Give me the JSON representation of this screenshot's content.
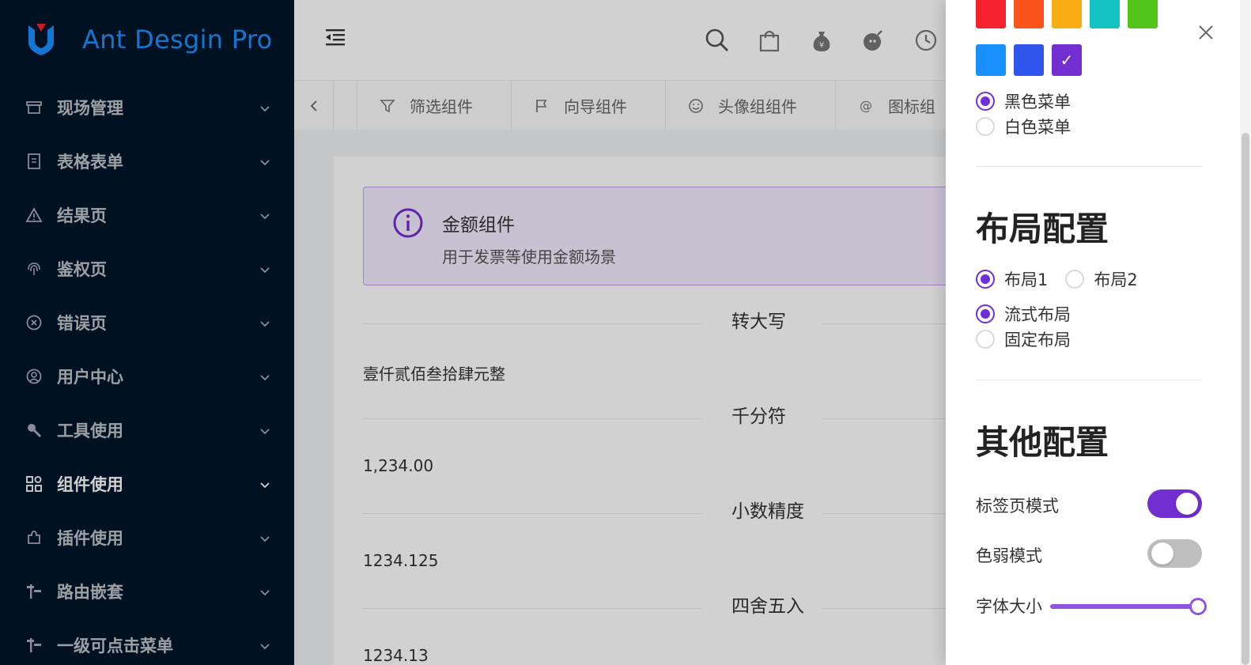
{
  "app": {
    "title": "Ant Desgin Pro"
  },
  "sidebar": {
    "items": [
      {
        "label": "现场管理",
        "icon": "shop-icon",
        "active": false
      },
      {
        "label": "表格表单",
        "icon": "form-icon",
        "active": false
      },
      {
        "label": "结果页",
        "icon": "warning-icon",
        "active": false
      },
      {
        "label": "鉴权页",
        "icon": "fingerprint-icon",
        "active": false
      },
      {
        "label": "错误页",
        "icon": "close-circle-icon",
        "active": false
      },
      {
        "label": "用户中心",
        "icon": "user-icon",
        "active": false
      },
      {
        "label": "工具使用",
        "icon": "tool-icon",
        "active": false
      },
      {
        "label": "组件使用",
        "icon": "appstore-icon",
        "active": true
      },
      {
        "label": "插件使用",
        "icon": "plugin-icon",
        "active": false
      },
      {
        "label": "路由嵌套",
        "icon": "route-icon",
        "active": false
      },
      {
        "label": "一级可点击菜单",
        "icon": "route-icon",
        "active": false
      }
    ]
  },
  "header": {
    "icons": [
      "search-icon",
      "shopping-bag-icon",
      "money-bag-icon",
      "bomb-icon",
      "clock-icon"
    ]
  },
  "tabs": [
    {
      "label": "筛选组件",
      "icon": "filter-icon"
    },
    {
      "label": "向导组件",
      "icon": "flag-icon"
    },
    {
      "label": "头像组组件",
      "icon": "smile-icon"
    },
    {
      "label": "图标组",
      "icon": "at-icon"
    }
  ],
  "alert": {
    "title": "金额组件",
    "description": "用于发票等使用金额场景"
  },
  "sections": [
    {
      "divider": "转大写",
      "value": "壹仟贰佰叁拾肆元整"
    },
    {
      "divider": "千分符",
      "value": "1,234.00"
    },
    {
      "divider": "小数精度",
      "value": "1234.125"
    },
    {
      "divider": "四舍五入",
      "value": "1234.13"
    }
  ],
  "drawer": {
    "colors": {
      "row1": [
        "#f5222d",
        "#fa541c",
        "#faad14",
        "#13c2c2",
        "#52c41a"
      ],
      "row2": [
        "#1890ff",
        "#2f54eb",
        "#722ed1"
      ],
      "selected": "#722ed1",
      "check": "✓"
    },
    "menu_theme": {
      "options": [
        "黑色菜单",
        "白色菜单"
      ],
      "selected": "黑色菜单"
    },
    "layout": {
      "title": "布局配置",
      "layout_options": [
        "布局1",
        "布局2"
      ],
      "layout_selected": "布局1",
      "width_options": [
        "流式布局",
        "固定布局"
      ],
      "width_selected": "流式布局"
    },
    "other": {
      "title": "其他配置",
      "tab_mode": {
        "label": "标签页模式",
        "on": true
      },
      "weak_mode": {
        "label": "色弱模式",
        "on": false
      },
      "font_size": {
        "label": "字体大小",
        "value": 1.0
      }
    }
  },
  "theme": {
    "accent": "#722ed1",
    "sidebar_bg": "#001529",
    "logo_blue": "#1890ff"
  }
}
